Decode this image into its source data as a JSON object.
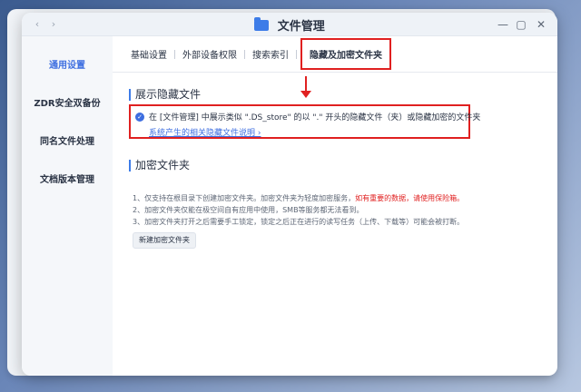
{
  "window": {
    "title": "文件管理",
    "back": "‹",
    "forward": "›",
    "minimize": "—",
    "maximize": "▢",
    "close": "✕"
  },
  "background_sidebar": [
    "≡",
    "×",
    "≡",
    "✎",
    "✎"
  ],
  "sidebar": {
    "items": [
      {
        "label": "通用设置",
        "active": true
      },
      {
        "label": "ZDR安全双备份",
        "active": false
      },
      {
        "label": "同名文件处理",
        "active": false
      },
      {
        "label": "文档版本管理",
        "active": false
      }
    ]
  },
  "tabs": [
    {
      "label": "基础设置"
    },
    {
      "label": "外部设备权限"
    },
    {
      "label": "搜索索引"
    },
    {
      "label": "隐藏及加密文件夹",
      "active": true
    }
  ],
  "show_hidden": {
    "title": "展示隐藏文件",
    "checked": true,
    "description": "在 [文件管理] 中展示类似 \".DS_store\" 的以 \".\" 开头的隐藏文件（夹）或隐藏加密的文件夹",
    "link": "系统产生的相关隐藏文件说明 ›"
  },
  "encrypt": {
    "title": "加密文件夹",
    "note1_prefix": "1、仅支持在根目录下创建加密文件夹。加密文件夹为轻度加密服务，",
    "note1_warn": "如有重要的数据，请使用保险箱。",
    "note2": "2、加密文件夹仅能在极空间自有应用中使用，SMB等服务都无法看到。",
    "note3": "3、加密文件夹打开之后需要手工锁定，锁定之后正在进行的读写任务（上传、下载等）可能会被打断。",
    "button": "新建加密文件夹"
  },
  "colors": {
    "accent": "#3d6ee0",
    "highlight_red": "#e02020"
  }
}
